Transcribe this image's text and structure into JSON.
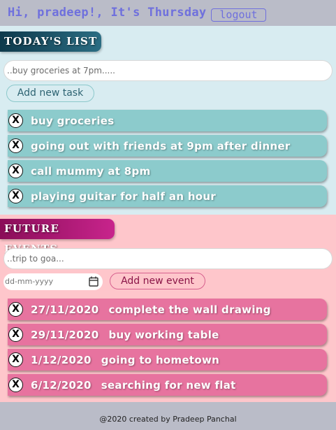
{
  "header": {
    "greeting": "Hi, pradeep!, It's Thursday",
    "logout_label": "logout"
  },
  "today": {
    "heading": "TODAY'S LIST",
    "input_placeholder": "..buy groceries at 7pm.....",
    "add_label": "Add new task",
    "remove_label": "X",
    "tasks": [
      "buy groceries",
      "going out with friends at 9pm after dinner",
      "call mummy at 8pm",
      "playing guitar for half an hour"
    ]
  },
  "future": {
    "heading": "FUTURE EVENTS",
    "input_placeholder": "..trip to goa...",
    "date_placeholder": "dd-mm-yyyy",
    "add_label": "Add new event",
    "remove_label": "X",
    "events": [
      {
        "date": "27/11/2020",
        "text": "complete the wall drawing"
      },
      {
        "date": "29/11/2020",
        "text": "buy working table"
      },
      {
        "date": "1/12/2020",
        "text": "going to hometown"
      },
      {
        "date": "6/12/2020",
        "text": "searching for new flat"
      }
    ]
  },
  "footer": {
    "text": "@2020 created by Pradeep Panchal"
  },
  "colors": {
    "greeting": "#6f70dd",
    "today_bg": "#d8ecf1",
    "future_bg": "#fec6cb",
    "task_item": "#8ccbcc",
    "event_item": "#e7739f"
  },
  "icons": [
    "close-icon",
    "calendar-icon"
  ]
}
